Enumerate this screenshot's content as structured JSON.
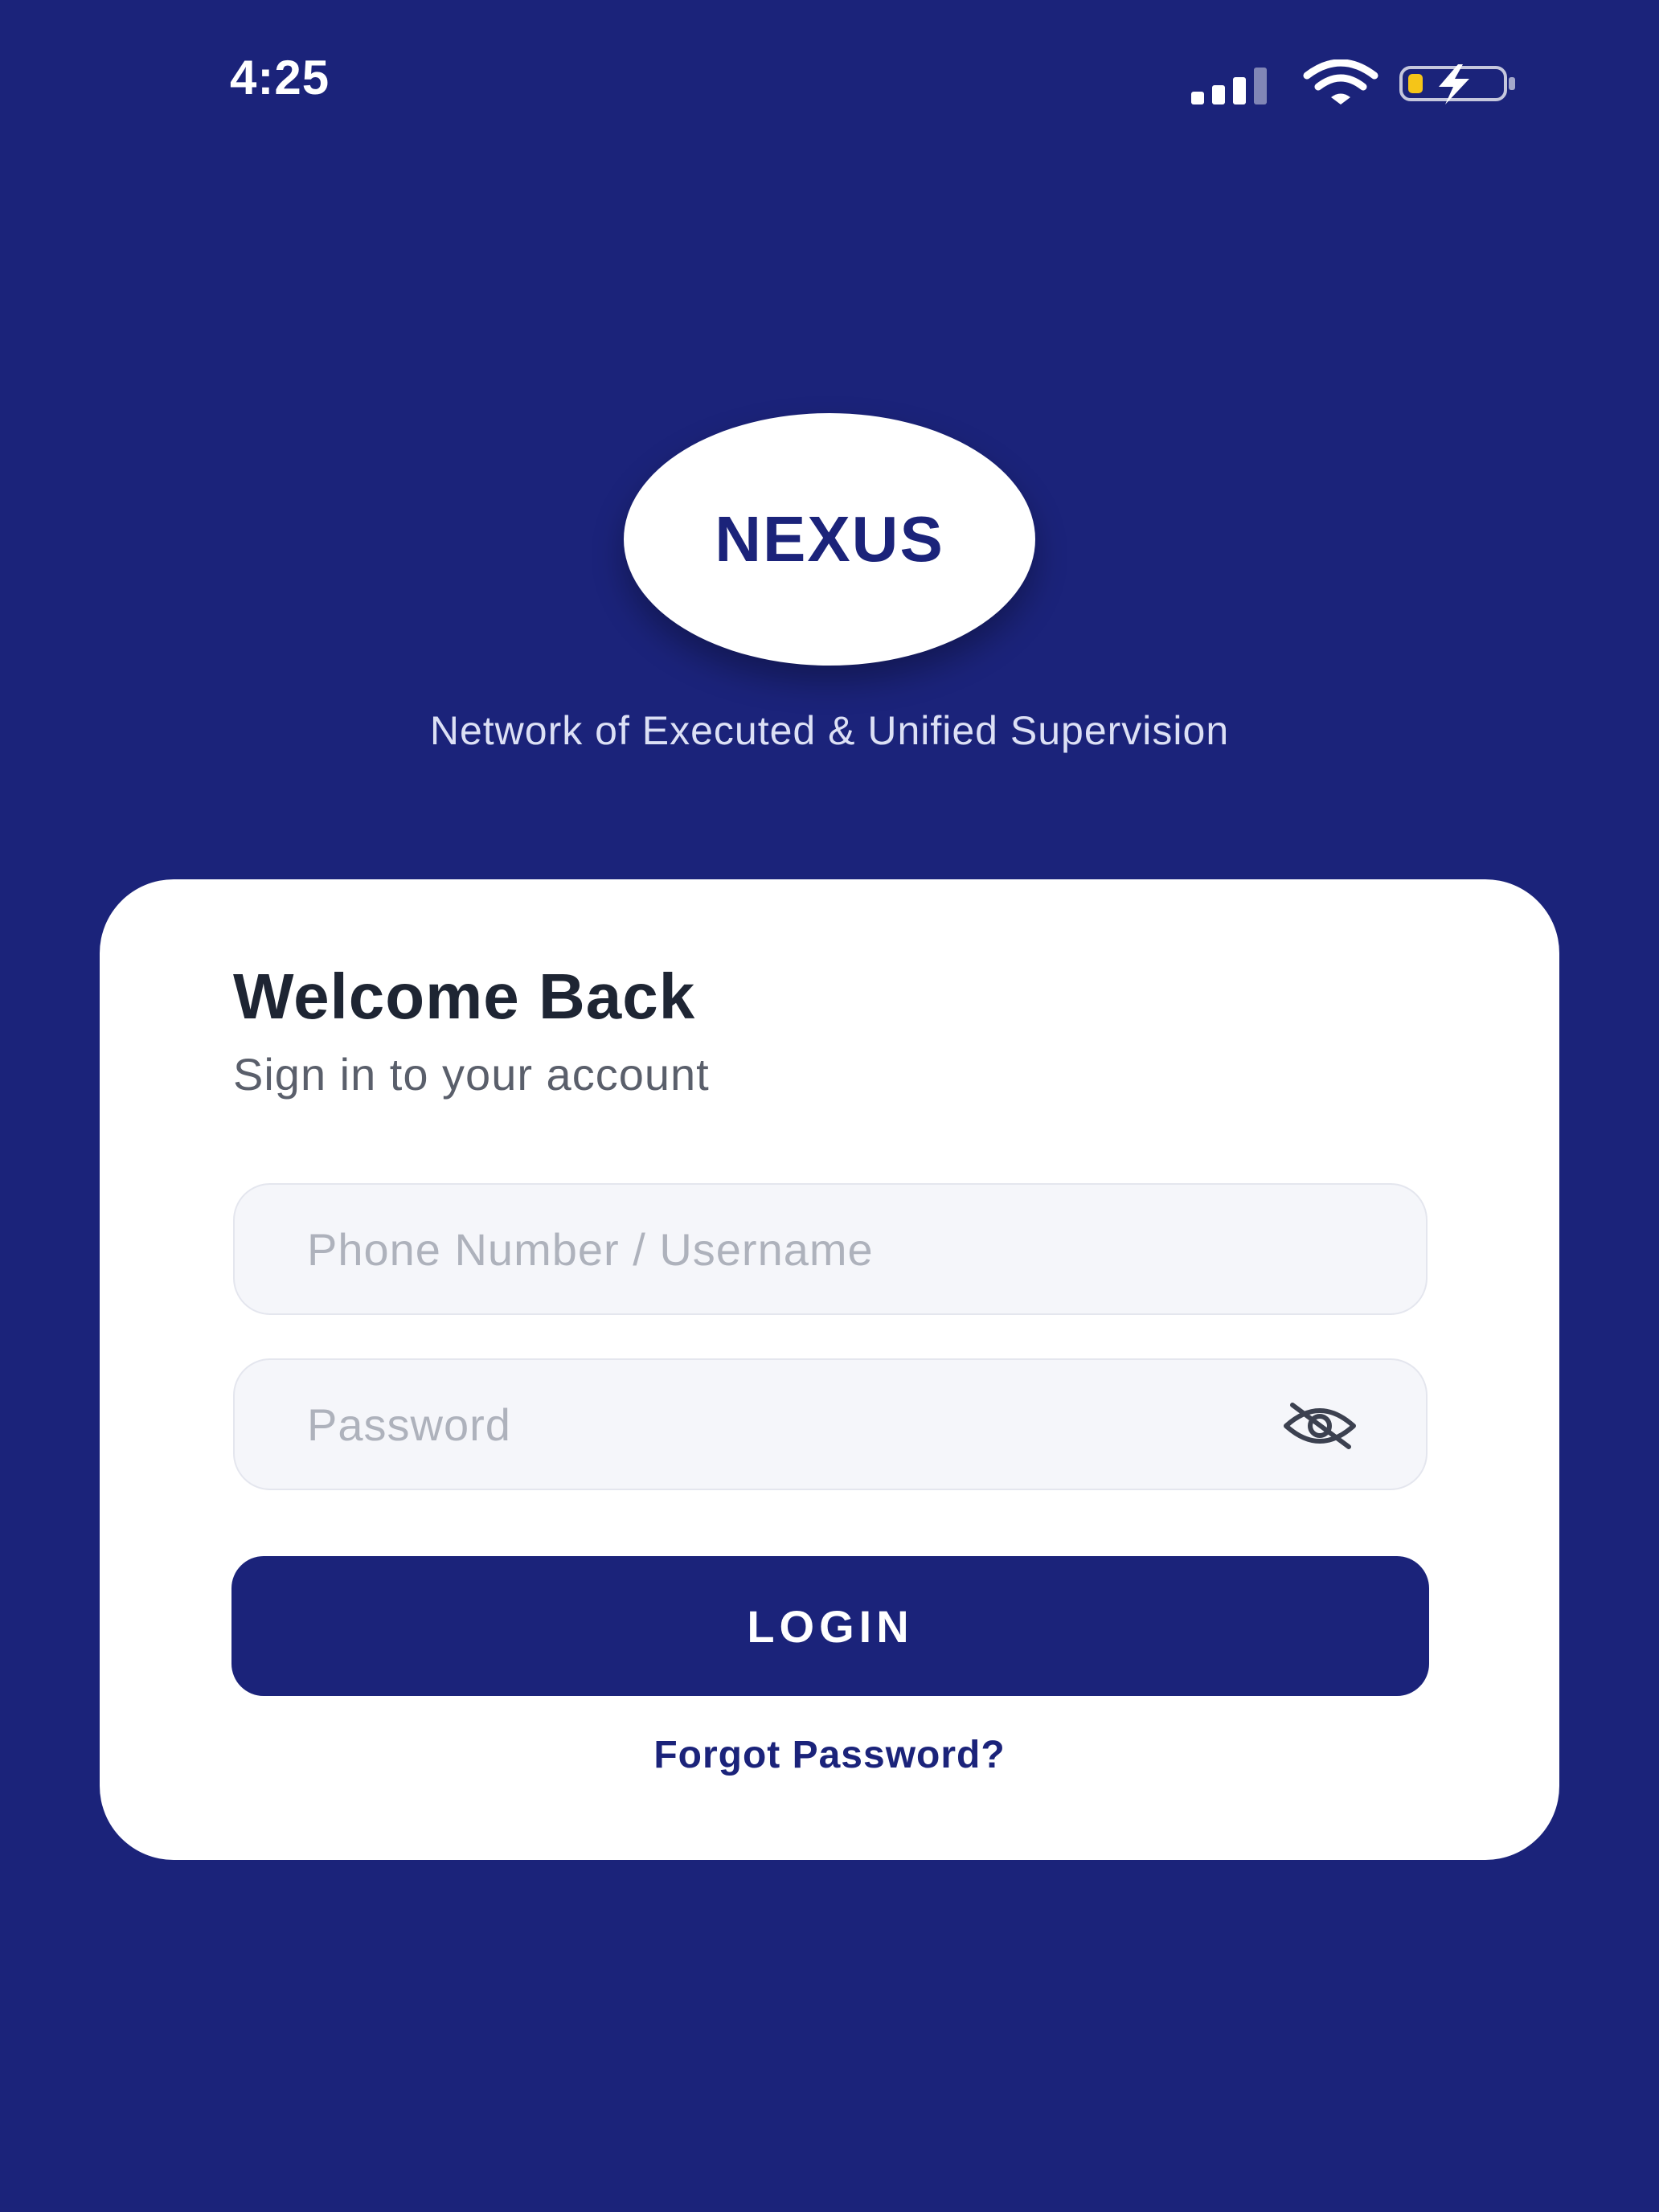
{
  "status_bar": {
    "time": "4:25",
    "icons": [
      "signal-icon",
      "wifi-icon",
      "battery-charging-icon"
    ]
  },
  "brand": {
    "logo_text": "NEXUS",
    "tagline": "Network of Executed & Unified Supervision"
  },
  "login_card": {
    "title": "Welcome Back",
    "subtitle": "Sign in to your account",
    "username_field": {
      "placeholder": "Phone Number / Username",
      "value": ""
    },
    "password_field": {
      "placeholder": "Password",
      "value": "",
      "toggle_icon": "eye-slash-icon"
    },
    "login_label": "LOGIN",
    "forgot_password_label": "Forgot Password?"
  },
  "colors": {
    "background": "#1B237A",
    "card": "#FFFFFF",
    "primary": "#1B237A",
    "battery_charge": "#F5C518"
  }
}
